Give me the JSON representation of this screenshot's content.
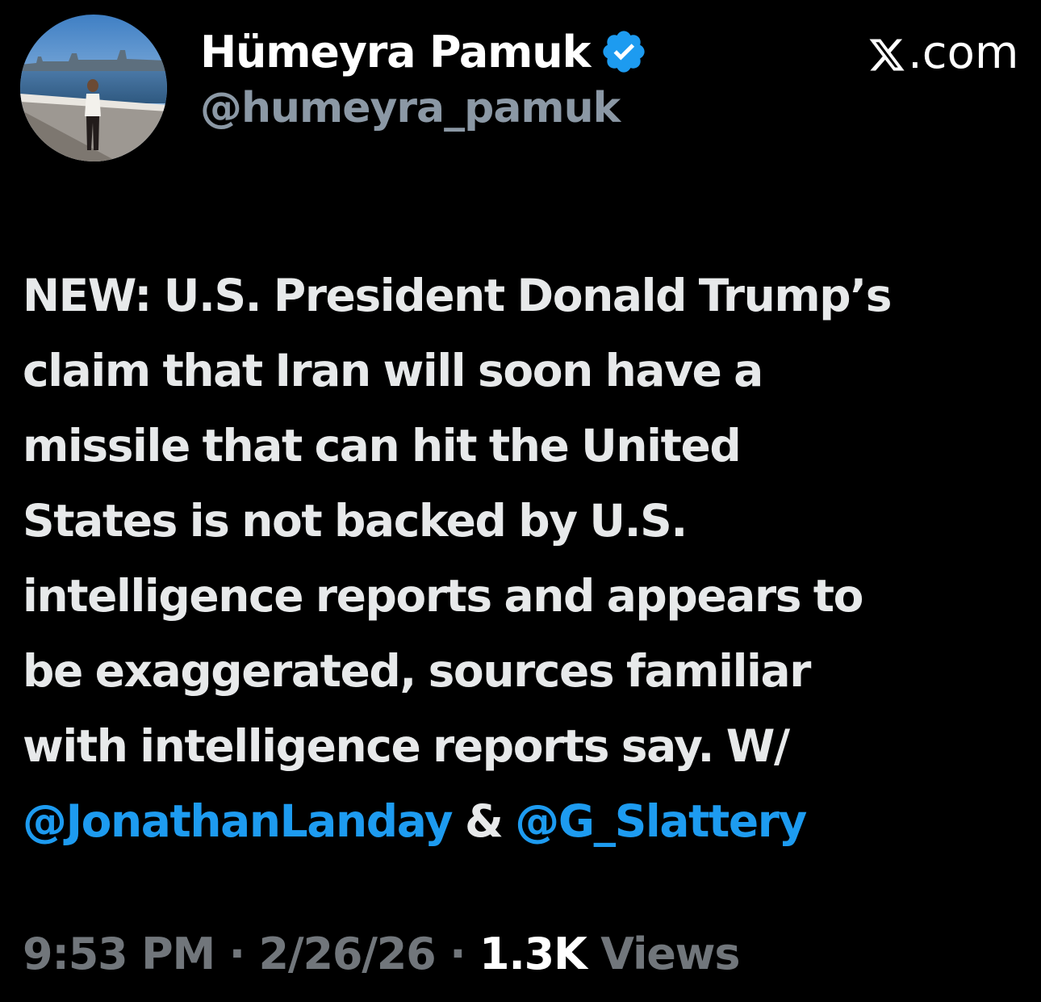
{
  "author": {
    "display_name": "Hümeyra Pamuk",
    "handle": "@humeyra_pamuk",
    "verified": true,
    "verified_color": "#1d9bf0"
  },
  "source_label": ".com",
  "source_logo": "x-logo",
  "tweet": {
    "lines": [
      "NEW: U.S. President Donald Trump’s",
      "claim that Iran will soon have a",
      "missile that can hit the United",
      "States is not backed by U.S.",
      "intelligence reports and appears to",
      "be exaggerated, sources familiar",
      "with intelligence reports say. W/"
    ],
    "mention_1": "@JonathanLanday",
    "connector": " & ",
    "mention_2": "@G_Slattery",
    "mention_color": "#1d9bf0"
  },
  "meta": {
    "time": "9:53 PM",
    "separator_1": " · ",
    "date": "2/26/26",
    "separator_2": " · ",
    "views_count": "1.3K",
    "views_label": " Views"
  }
}
